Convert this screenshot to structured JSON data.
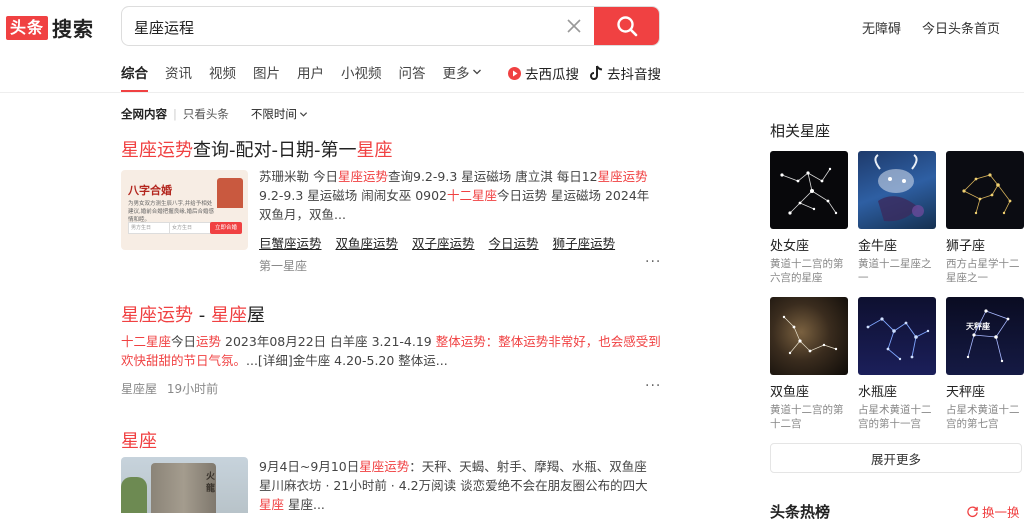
{
  "header": {
    "logo_box": "头条",
    "logo_text": "搜索",
    "search_value": "星座运程",
    "links": [
      "无障碍",
      "今日头条首页"
    ]
  },
  "tabs": {
    "items": [
      "综合",
      "资讯",
      "视频",
      "图片",
      "用户",
      "小视频",
      "问答",
      "更多"
    ],
    "ext": [
      "去西瓜搜",
      "去抖音搜"
    ]
  },
  "filters": {
    "all": "全网内容",
    "only": "只看头条",
    "time": "不限时间"
  },
  "results": [
    {
      "title_parts": [
        "星座运势",
        "查询-配对-日期-第一",
        "星座"
      ],
      "thumb_title": "八字合婚",
      "thumb_text": "为男女双方测生辰八字,并给予相处建议,婚前合婚把握良缘,婚后合婚感情和睦。",
      "thumb_f1": "男方生日",
      "thumb_f2": "女方生日",
      "thumb_btn": "立即合婚",
      "snippet_parts": [
        "苏珊米勒 今日",
        "星座运势",
        "查询9.2-9.3 星运磁场 唐立淇 每日12",
        "星座运势",
        "9.2-9.3 星运磁场 闹闹女巫 0902",
        "十二星座",
        "今日运势 星运磁场 2024年双鱼月，双鱼..."
      ],
      "sublinks": [
        "巨蟹座运势",
        "双鱼座运势",
        "双子座运势",
        "今日运势",
        "狮子座运势"
      ],
      "source": "第一星座"
    },
    {
      "title_parts": [
        "星座运势",
        " - ",
        "星座",
        "屋"
      ],
      "snippet_parts": [
        "十二星座",
        "今日",
        "运势",
        " 2023年08月22日 白羊座 3.21-4.19 ",
        "整体运势：整体运势非常好，也会感受到欢快甜甜的节日气氛。",
        "...[详细]金牛座 4.20-5.20 整体运..."
      ],
      "source": "星座屋",
      "time": "19小时前"
    },
    {
      "title": "星座",
      "snippet_parts": [
        "9月4日~9月10日",
        "星座运势",
        "：天秤、天蝎、射手、摩羯、水瓶、双鱼座"
      ],
      "line2": "星川麻衣坊 · 21小时前 · 4.2万阅读 谈恋爱绝不会在朋友圈公布的四大",
      "line3_parts": [
        "星座",
        " 星座..."
      ],
      "stone_text": "火 龍"
    }
  ],
  "sidebar": {
    "title": "相关星座",
    "cards": [
      {
        "name": "处女座",
        "desc": "黄道十二宫的第六宫的星座"
      },
      {
        "name": "金牛座",
        "desc": "黄道十二星座之一"
      },
      {
        "name": "狮子座",
        "desc": "西方占星学十二星座之一"
      },
      {
        "name": "双鱼座",
        "desc": "黄道十二宫的第十二宫"
      },
      {
        "name": "水瓶座",
        "desc": "占星术黄道十二宫的第十一宫"
      },
      {
        "name": "天秤座",
        "desc": "占星术黄道十二宫的第七宫"
      }
    ],
    "libra_label": "天秤座",
    "expand": "展开更多",
    "hot_title": "头条热榜",
    "refresh": "换一换"
  },
  "colors": {
    "accent": "#f04142"
  }
}
